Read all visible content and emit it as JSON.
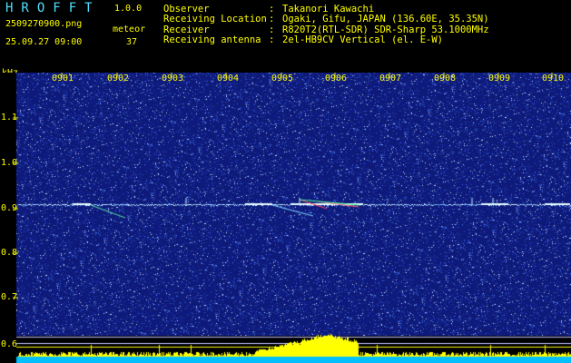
{
  "header": {
    "logo": "HROFFT",
    "version": "1.0.0",
    "filename": "2509270900.png",
    "mode": "meteor",
    "datetime": "25.09.27 09:00",
    "count": "37"
  },
  "info": [
    {
      "label": "Observer",
      "sep": ":",
      "value": "Takanori Kawachi"
    },
    {
      "label": "Receiving Location",
      "sep": ":",
      "value": "Ogaki, Gifu, JAPAN (136.60E, 35.35N)"
    },
    {
      "label": "Receiver",
      "sep": ":",
      "value": "R820T2(RTL-SDR) SDR-Sharp 53.1000MHz"
    },
    {
      "label": "Receiving antenna",
      "sep": ":",
      "value": "2el-HB9CV Vertical (el. E-W)"
    }
  ],
  "axes": {
    "y_unit": "kHz",
    "x_ticks": [
      "0901",
      "0902",
      "0903",
      "0904",
      "0905",
      "0906",
      "0907",
      "0908",
      "0909",
      "0910"
    ],
    "y_ticks": [
      "1.1",
      "1.0",
      "0.9",
      "0.8",
      "0.7",
      "0.6"
    ]
  },
  "colors": {
    "text": "#ffff00",
    "logo": "#4fe0ff",
    "background": "#000000",
    "noise_base": "#101c70",
    "signal": "#bfefff",
    "bars": "#ffff00",
    "baseline": "#00bfff"
  }
}
